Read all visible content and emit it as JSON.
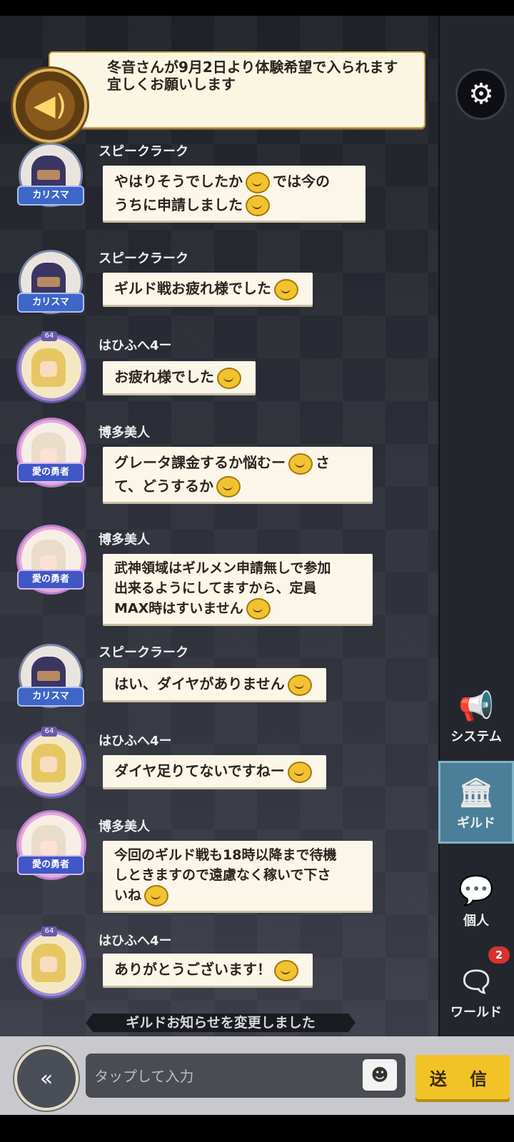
{
  "announcement": {
    "text": "冬音さんが9月2日より体験希望で入られます宜しくお願いします"
  },
  "messages": [
    {
      "name": "スピークラーク",
      "badge": "カリスマ",
      "lines": [
        "やはりそうでしたか",
        "では今の",
        "うちに申請しました"
      ],
      "type": "ninja"
    },
    {
      "name": "スピークラーク",
      "badge": "カリスマ",
      "lines": [
        "ギルド戦お疲れ様でした"
      ],
      "type": "ninja"
    },
    {
      "name": "はひふへ4ー",
      "badge": "",
      "lines": [
        "お疲れ様でした"
      ],
      "type": "gold"
    },
    {
      "name": "博多美人",
      "badge": "愛の勇者",
      "lines": [
        "グレータ課金するか悩むー",
        "さ",
        "て、どうするか"
      ],
      "type": "pink"
    },
    {
      "name": "博多美人",
      "badge": "愛の勇者",
      "lines": [
        "武神領域はギルメン申請無しで参加",
        "出来るようにしてますから、定員",
        "MAX時はすいません"
      ],
      "type": "pink"
    },
    {
      "name": "スピークラーク",
      "badge": "カリスマ",
      "lines": [
        "はい、ダイヤがありません"
      ],
      "type": "ninja"
    },
    {
      "name": "はひふへ4ー",
      "badge": "",
      "lines": [
        "ダイヤ足りてないですねー"
      ],
      "type": "gold"
    },
    {
      "name": "博多美人",
      "badge": "愛の勇者",
      "lines": [
        "今回のギルド戦も18時以降まで待機",
        "しときますので遠慮なく稼いで下さ",
        "いね"
      ],
      "type": "pink"
    },
    {
      "name": "はひふへ4ー",
      "badge": "",
      "lines": [
        "ありがとうございます！"
      ],
      "type": "gold"
    }
  ],
  "level_badge": "64",
  "system_notice": "ギルドお知らせを変更しました",
  "input": {
    "placeholder": "タップして入力"
  },
  "send_label": "送 信",
  "sidebar": {
    "tabs": [
      {
        "label": "システム",
        "icon": "megaphone-icon"
      },
      {
        "label": "ギルド",
        "icon": "guild-building-icon",
        "active": true
      },
      {
        "label": "個人",
        "icon": "chat-bubble-icon"
      },
      {
        "label": "ワールド",
        "icon": "world-chat-icon",
        "notification": "2"
      }
    ]
  },
  "colors": {
    "accent": "#f2c327",
    "active_tab": "#4b7f97",
    "bubble": "#fbf6e8"
  }
}
